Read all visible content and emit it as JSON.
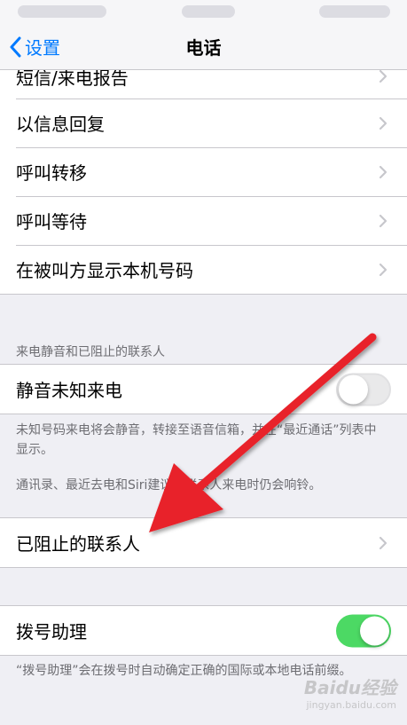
{
  "nav": {
    "back_label": "设置",
    "title": "电话"
  },
  "group1": [
    {
      "label": "短信/来电报告"
    },
    {
      "label": "以信息回复"
    },
    {
      "label": "呼叫转移"
    },
    {
      "label": "呼叫等待"
    },
    {
      "label": "在被叫方显示本机号码"
    }
  ],
  "silence": {
    "header": "来电静音和已阻止的联系人",
    "label": "静音未知来电",
    "toggle_on": false,
    "footer1": "未知号码来电将会静音，转接至语音信箱，并在“最近通话”列表中显示。",
    "footer2": "通讯录、最近去电和Siri建议的联系人来电时仍会响铃。"
  },
  "blocked": {
    "label": "已阻止的联系人"
  },
  "assist": {
    "label": "拨号助理",
    "toggle_on": true,
    "footer": "“拨号助理”会在拨号时自动确定正确的国际或本地电话前缀。"
  },
  "watermark": {
    "text": "Baidu经验",
    "sub": "jingyan.baidu.com"
  },
  "colors": {
    "accent": "#007aff",
    "toggle_on": "#4cd964",
    "arrow": "#e8242c"
  }
}
